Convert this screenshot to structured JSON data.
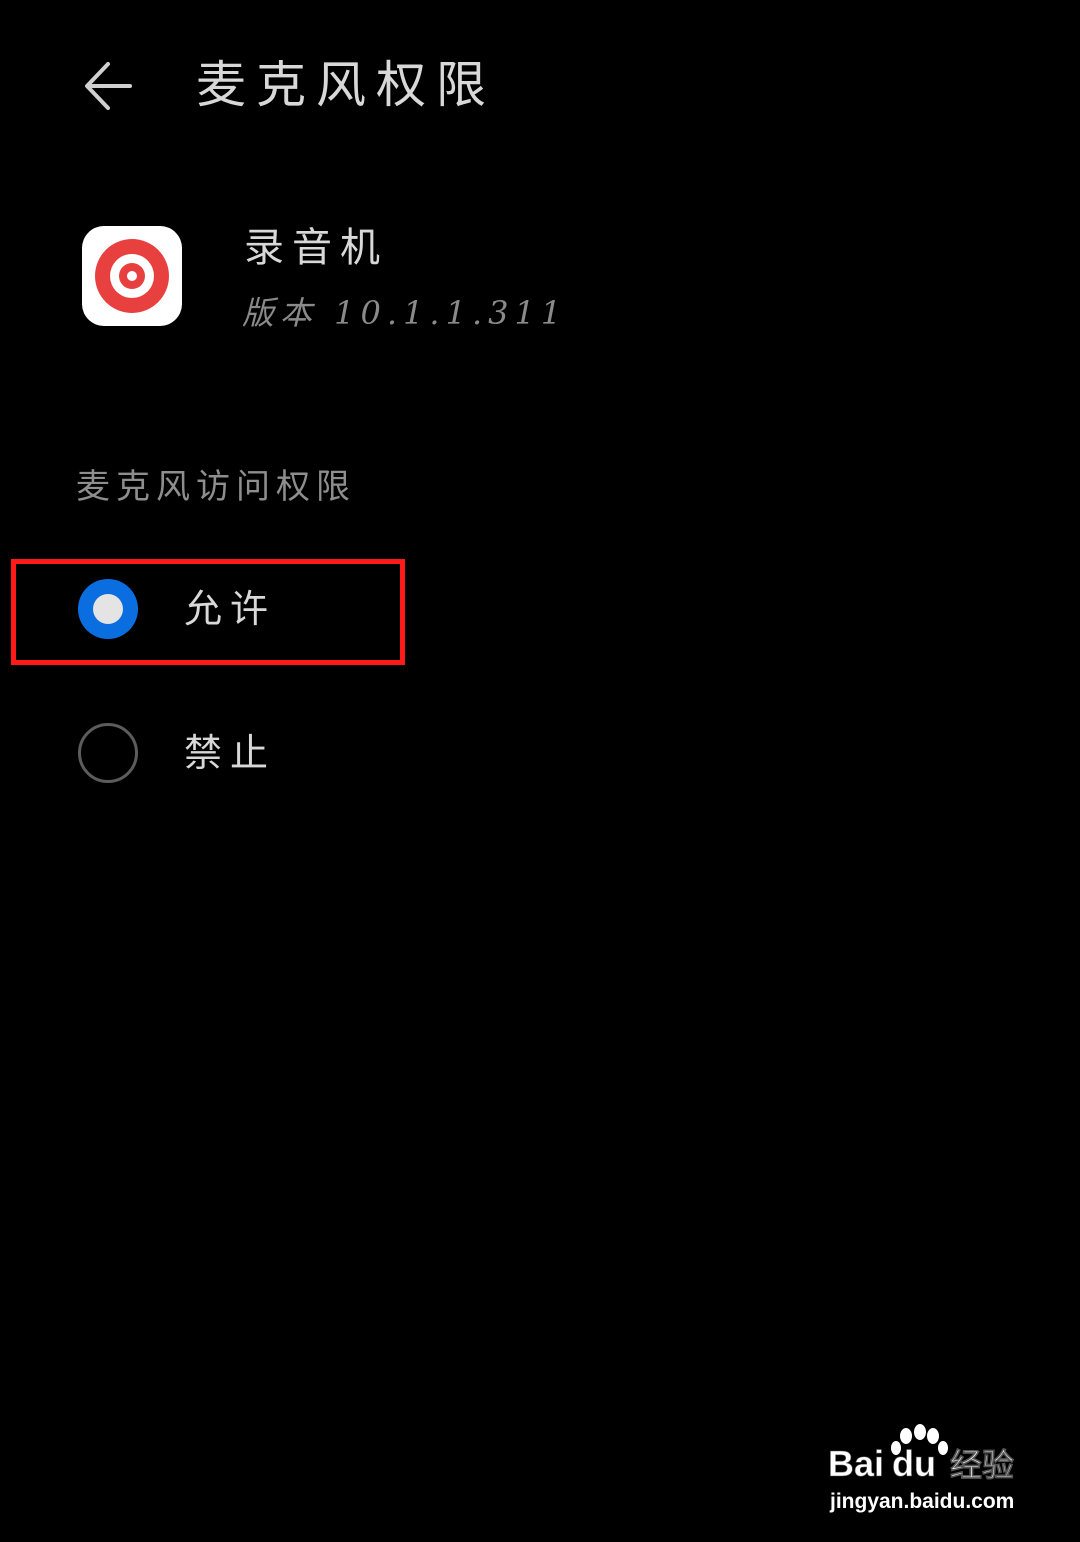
{
  "header": {
    "title": "麦克风权限",
    "back_icon": "arrow-left-icon"
  },
  "app": {
    "name": "录音机",
    "version": "版本 10.1.1.311",
    "icon": "recorder-app-icon",
    "icon_color": "#e8403e"
  },
  "permission": {
    "section_label": "麦克风访问权限",
    "options": [
      {
        "label": "允许",
        "selected": true
      },
      {
        "label": "禁止",
        "selected": false
      }
    ]
  },
  "colors": {
    "background": "#000000",
    "radio_selected": "#0a6ee0",
    "highlight": "#ff1a1a"
  },
  "watermark": {
    "logo_text": "Baidu经验",
    "url": "jingyan.baidu.com"
  }
}
